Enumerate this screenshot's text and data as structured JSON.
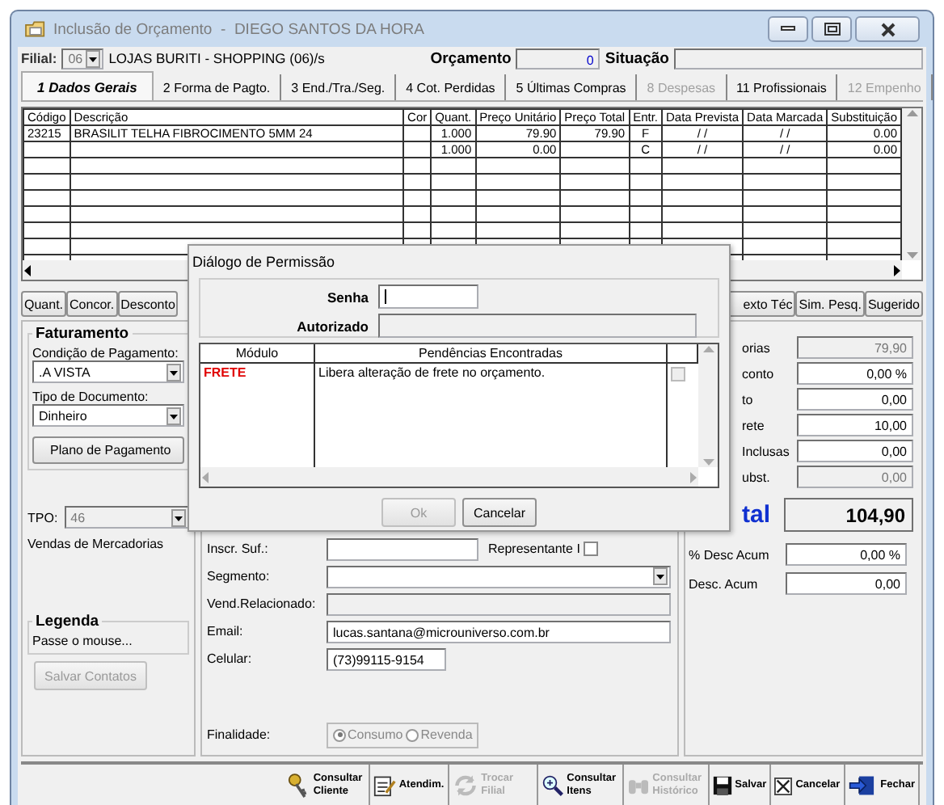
{
  "window": {
    "title": "Inclusão de Orçamento  -  DIEGO SANTOS DA HORA"
  },
  "header": {
    "filial_label": "Filial:",
    "filial_code": "06",
    "filial_name": "LOJAS BURITI - SHOPPING (06)/s",
    "orcamento_label": "Orçamento",
    "orcamento_value": "0",
    "situacao_label": "Situação"
  },
  "tabs": [
    {
      "label": "1 Dados Gerais",
      "selected": true,
      "disabled": false
    },
    {
      "label": "2 Forma de Pagto.",
      "selected": false,
      "disabled": false
    },
    {
      "label": "3 End./Tra./Seg.",
      "selected": false,
      "disabled": false
    },
    {
      "label": "4 Cot. Perdidas",
      "selected": false,
      "disabled": false
    },
    {
      "label": "5 Últimas Compras",
      "selected": false,
      "disabled": false
    },
    {
      "label": "8 Despesas",
      "selected": false,
      "disabled": true
    },
    {
      "label": "11 Profissionais",
      "selected": false,
      "disabled": false
    },
    {
      "label": "12 Empenho",
      "selected": false,
      "disabled": true
    }
  ],
  "grid": {
    "columns": [
      "Código",
      "Descrição",
      "Cor",
      "Quant.",
      "Preço Unitário",
      "Preço Total",
      "Entr.",
      "Data Prevista",
      "Data Marcada",
      "Substituição"
    ],
    "rows": [
      [
        "23215",
        "BRASILIT TELHA FIBROCIMENTO 5MM 24",
        null,
        "1.000",
        "79.90",
        "79.90",
        "F",
        "/ /",
        "/ /",
        "0.00"
      ],
      [
        null,
        null,
        null,
        "1.000",
        "0.00",
        null,
        "C",
        "/ /",
        "/ /",
        "0.00"
      ]
    ]
  },
  "grid_buttons_left": [
    "Quant.",
    "Concor.",
    "Desconto"
  ],
  "grid_buttons_right": [
    "exto Téc",
    "Sim. Pesq.",
    "Sugerido"
  ],
  "faturamento": {
    "title": "Faturamento",
    "condicao_label": "Condição de Pagamento:",
    "condicao_value": ".A VISTA",
    "tipo_label": "Tipo de Documento:",
    "tipo_value": "Dinheiro",
    "plano_button": "Plano de Pagamento",
    "tpo_label": "TPO:",
    "tpo_value": "46",
    "tpo_description": "Vendas de Mercadorias"
  },
  "legenda": {
    "title": "Legenda",
    "text": "Passe o mouse..."
  },
  "salvar_contatos": {
    "label": "Salvar Contatos",
    "disabled": true
  },
  "cliente": {
    "inscr_label": "Inscr. Suf.:",
    "representante_label": "Representante I",
    "representante_checked": false,
    "segmento_label": "Segmento:",
    "vend_label": "Vend.Relacionado:",
    "email_label": "Email:",
    "email_value": "lucas.santana@microuniverso.com.br",
    "celular_label": "Celular:",
    "celular_value": "(73)99115-9154",
    "finalidade_label": "Finalidade:",
    "finalidade_options": [
      {
        "label": "Consumo",
        "selected": true
      },
      {
        "label": "Revenda",
        "selected": false
      }
    ]
  },
  "totals": [
    {
      "label": "orias",
      "value": "79,90",
      "disabled": true
    },
    {
      "label": "conto",
      "value": "0,00 %",
      "disabled": false
    },
    {
      "label": "to",
      "value": "0,00",
      "disabled": false
    },
    {
      "label": "rete",
      "value": "10,00",
      "disabled": false
    },
    {
      "label": "Inclusas",
      "value": "0,00",
      "disabled": false
    },
    {
      "label": "ubst.",
      "value": "0,00",
      "disabled": true
    }
  ],
  "total": {
    "label": "tal",
    "value": "104,90"
  },
  "accumulated": [
    {
      "label": "% Desc Acum",
      "value": "0,00 %"
    },
    {
      "label": "Desc. Acum",
      "value": "0,00"
    }
  ],
  "toolbar": [
    {
      "label": "Consultar Cliente",
      "kind": "keys",
      "disabled": false
    },
    {
      "label": "Atendim.",
      "kind": "notepad",
      "disabled": false
    },
    {
      "label": "Trocar Filial",
      "kind": "refresh",
      "disabled": true
    },
    {
      "label": "Consultar Itens",
      "kind": "magnifier",
      "disabled": false
    },
    {
      "label": "Consultar Histórico",
      "kind": "binoculars",
      "disabled": true
    },
    {
      "label": "Salvar",
      "kind": "floppy",
      "disabled": false
    },
    {
      "label": "Cancelar",
      "kind": "cross",
      "disabled": false
    },
    {
      "label": "Fechar",
      "kind": "exit",
      "disabled": false
    }
  ],
  "dialog": {
    "title": "Diálogo de Permissão",
    "senha_label": "Senha",
    "autorizado_label": "Autorizado",
    "columns": [
      "Módulo",
      "Pendências Encontradas"
    ],
    "rows": [
      {
        "modulo": "FRETE",
        "pendencia": "Libera alteração de frete no orçamento.",
        "checked": false
      }
    ],
    "ok": {
      "label": "Ok",
      "disabled": true
    },
    "cancel": {
      "label": "Cancelar",
      "disabled": false
    }
  }
}
